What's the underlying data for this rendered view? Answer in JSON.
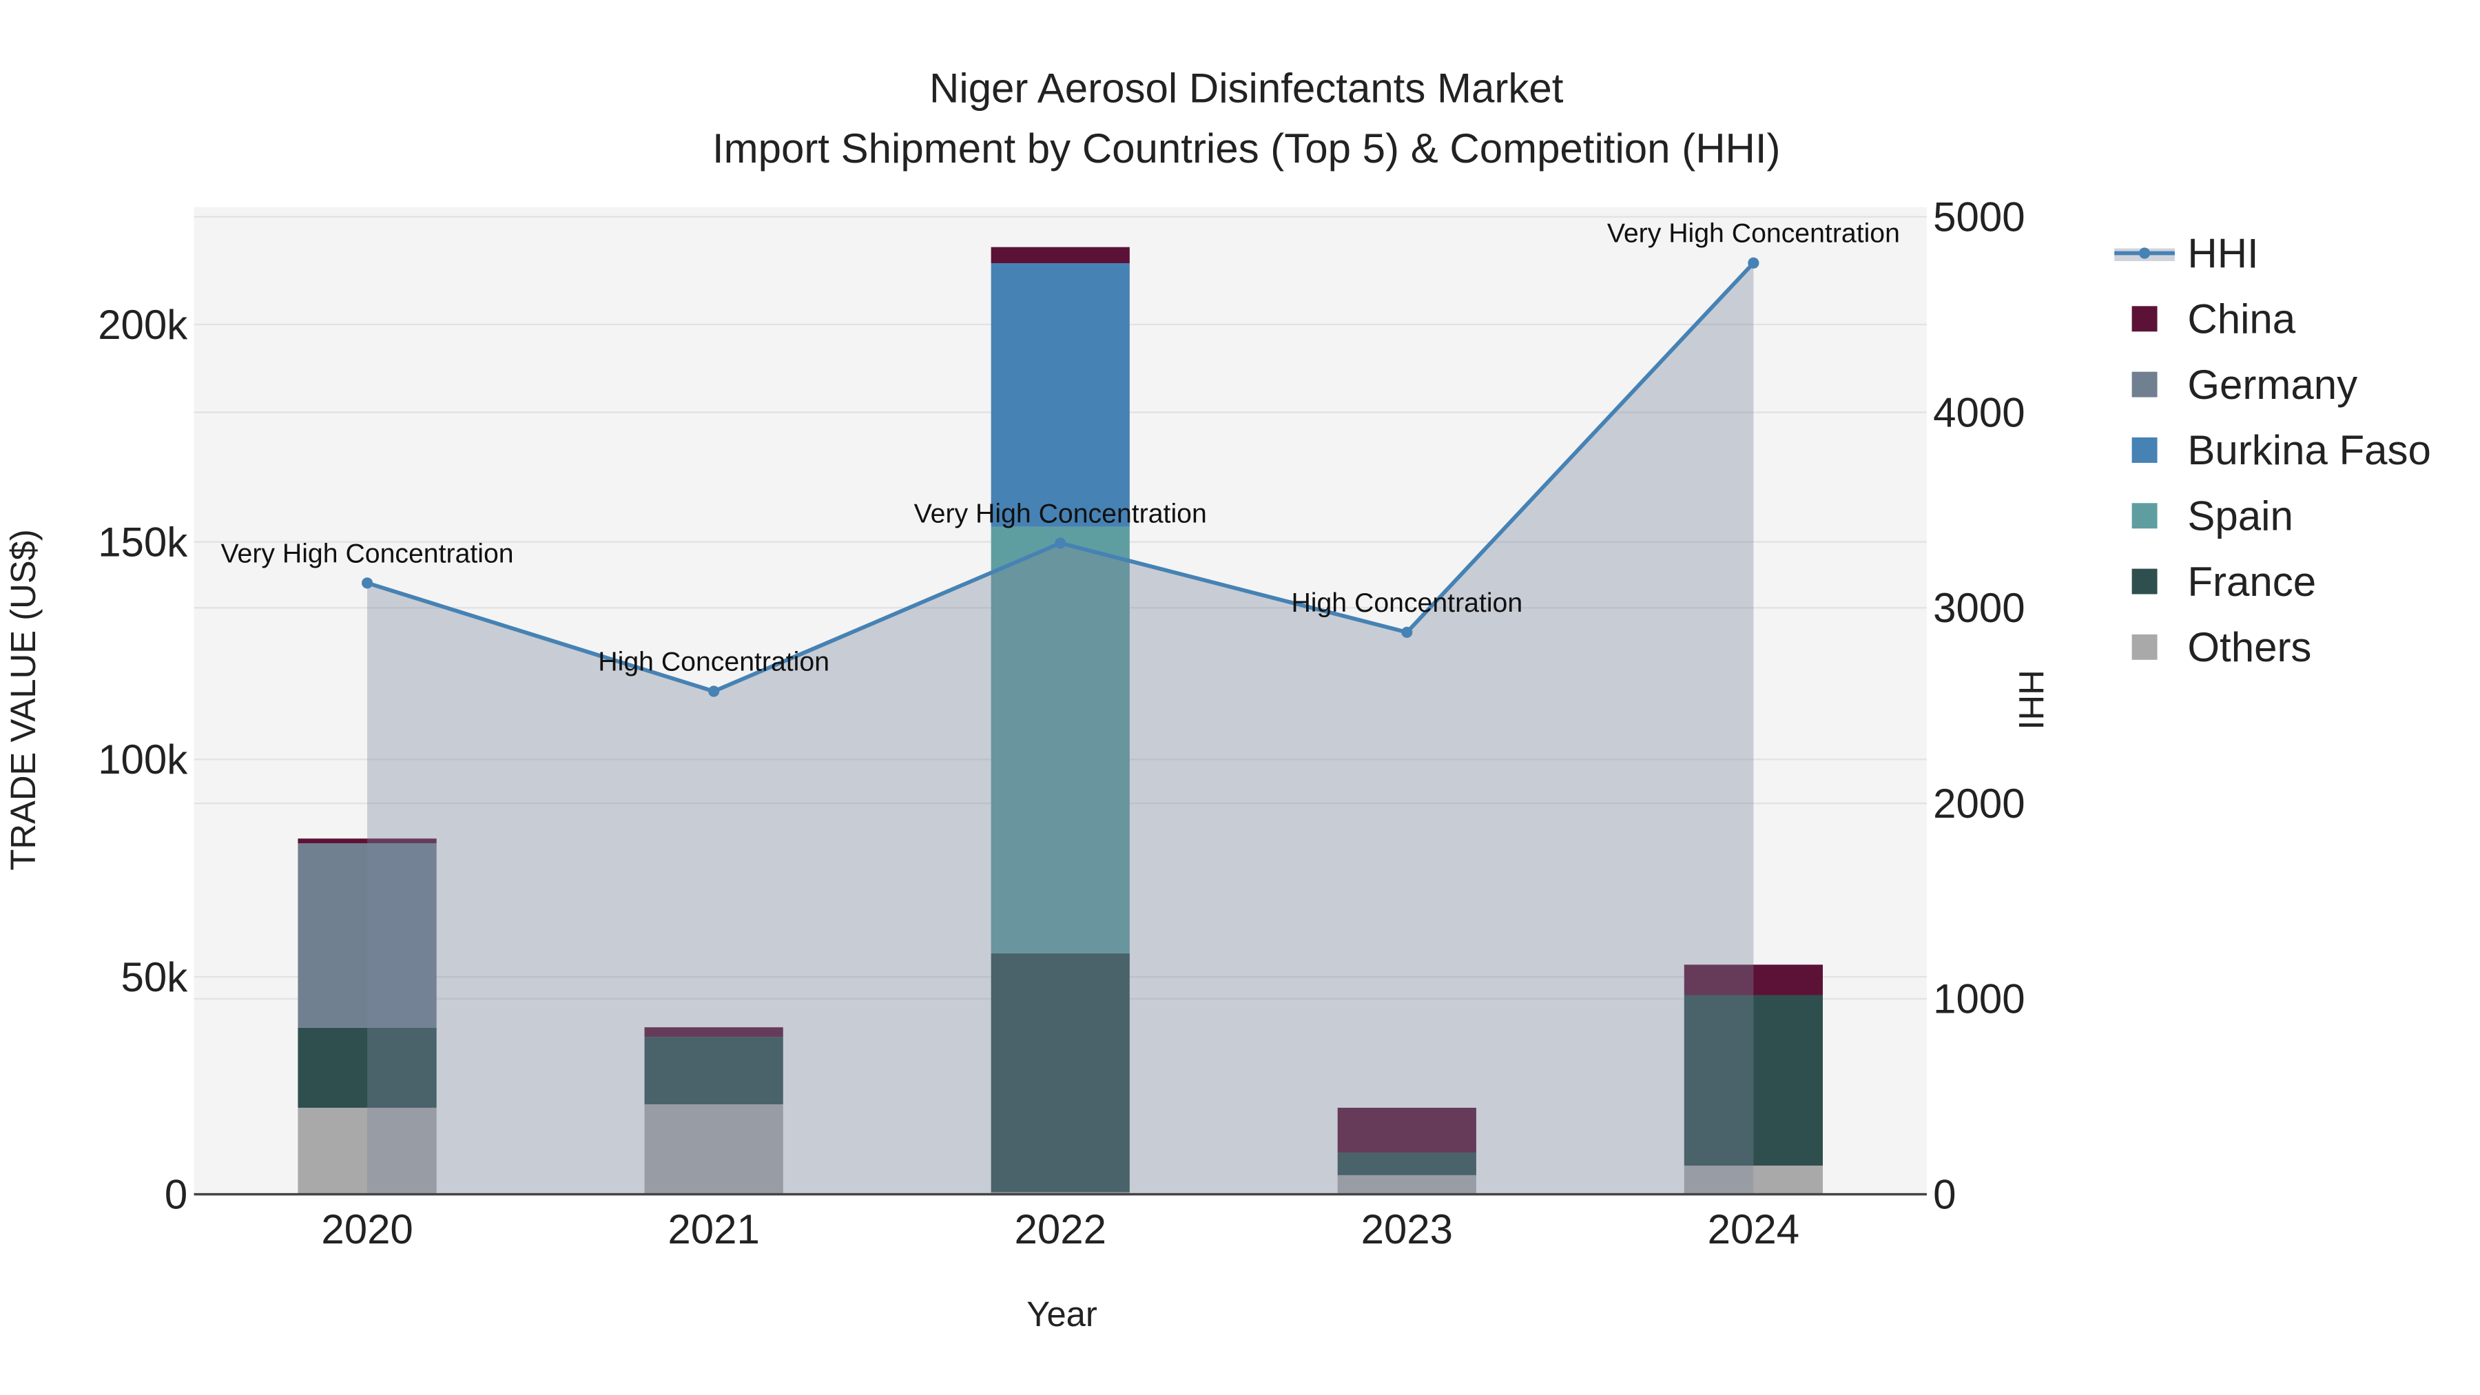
{
  "chart_data": {
    "type": "bar",
    "title_line1": "Niger Aerosol Disinfectants Market",
    "title_line2": "Import Shipment by Countries (Top 5) & Competition (HHI)",
    "xlabel": "Year",
    "ylabel": "TRADE VALUE (US$)",
    "y2label": "HHI",
    "categories": [
      "2020",
      "2021",
      "2022",
      "2023",
      "2024"
    ],
    "ylim": [
      0,
      227000
    ],
    "y2lim": [
      0,
      5050
    ],
    "yticks": [
      0,
      50000,
      100000,
      150000,
      200000
    ],
    "ytick_labels": [
      "0",
      "50k",
      "100k",
      "150k",
      "200k"
    ],
    "y2ticks": [
      0,
      1000,
      2000,
      3000,
      4000,
      5000
    ],
    "y2tick_labels": [
      "0",
      "1000",
      "2000",
      "3000",
      "4000",
      "5000"
    ],
    "grid": true,
    "legend_position": "right",
    "series": [
      {
        "name": "Others",
        "color": "#a9a9a9",
        "values": [
          19900,
          20700,
          500,
          4400,
          6600
        ]
      },
      {
        "name": "France",
        "color": "#2f4f4f",
        "values": [
          18400,
          15500,
          54900,
          5200,
          39200
        ]
      },
      {
        "name": "Spain",
        "color": "#5f9ea0",
        "values": [
          0,
          0,
          98100,
          0,
          0
        ]
      },
      {
        "name": "Burkina Faso",
        "color": "#4682b4",
        "values": [
          0,
          0,
          60600,
          0,
          0
        ]
      },
      {
        "name": "Germany",
        "color": "#708090",
        "values": [
          42400,
          0,
          0,
          0,
          0
        ]
      },
      {
        "name": "China",
        "color": "#5c1236",
        "values": [
          1100,
          2200,
          3700,
          10300,
          7000
        ]
      }
    ],
    "hhi": {
      "name": "HHI",
      "color": "#4682b4",
      "values": [
        3127,
        2573,
        3331,
        2875,
        4764
      ],
      "labels": [
        "Very High Concentration",
        "High Concentration",
        "Very High Concentration",
        "High Concentration",
        "Very High Concentration"
      ]
    },
    "legend": [
      "HHI",
      "China",
      "Germany",
      "Burkina Faso",
      "Spain",
      "France",
      "Others"
    ]
  }
}
